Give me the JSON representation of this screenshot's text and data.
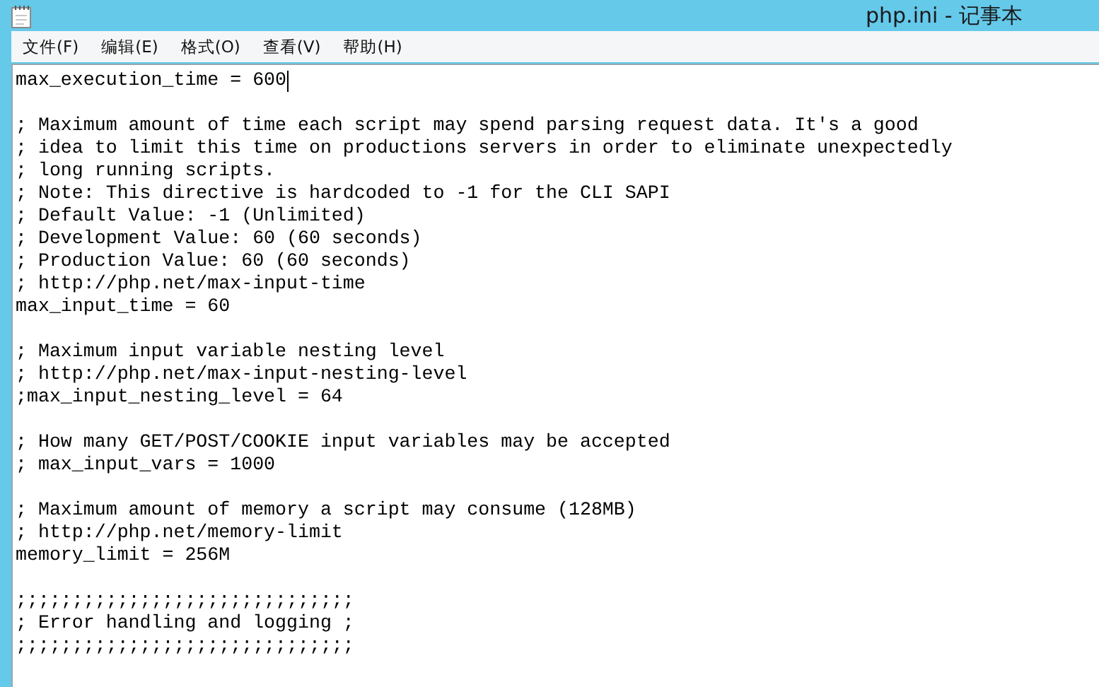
{
  "window": {
    "title": "php.ini - 记事本"
  },
  "menu": [
    "文件(F)",
    "编辑(E)",
    "格式(O)",
    "查看(V)",
    "帮助(H)"
  ],
  "editor": {
    "blocks": [
      [
        "max_execution_time = 600"
      ],
      [
        "; Maximum amount of time each script may spend parsing request data. It's a good",
        "; idea to limit this time on productions servers in order to eliminate unexpectedly",
        "; long running scripts.",
        "; Note: This directive is hardcoded to -1 for the CLI SAPI",
        "; Default Value: -1 (Unlimited)",
        "; Development Value: 60 (60 seconds)",
        "; Production Value: 60 (60 seconds)",
        "; http://php.net/max-input-time",
        "max_input_time = 60"
      ],
      [
        "; Maximum input variable nesting level",
        "; http://php.net/max-input-nesting-level",
        ";max_input_nesting_level = 64"
      ],
      [
        "; How many GET/POST/COOKIE input variables may be accepted",
        "; max_input_vars = 1000"
      ],
      [
        "; Maximum amount of memory a script may consume (128MB)",
        "; http://php.net/memory-limit",
        "memory_limit = 256M"
      ],
      [
        ";;;;;;;;;;;;;;;;;;;;;;;;;;;;;;",
        "; Error handling and logging ;",
        ";;;;;;;;;;;;;;;;;;;;;;;;;;;;;;"
      ]
    ]
  }
}
